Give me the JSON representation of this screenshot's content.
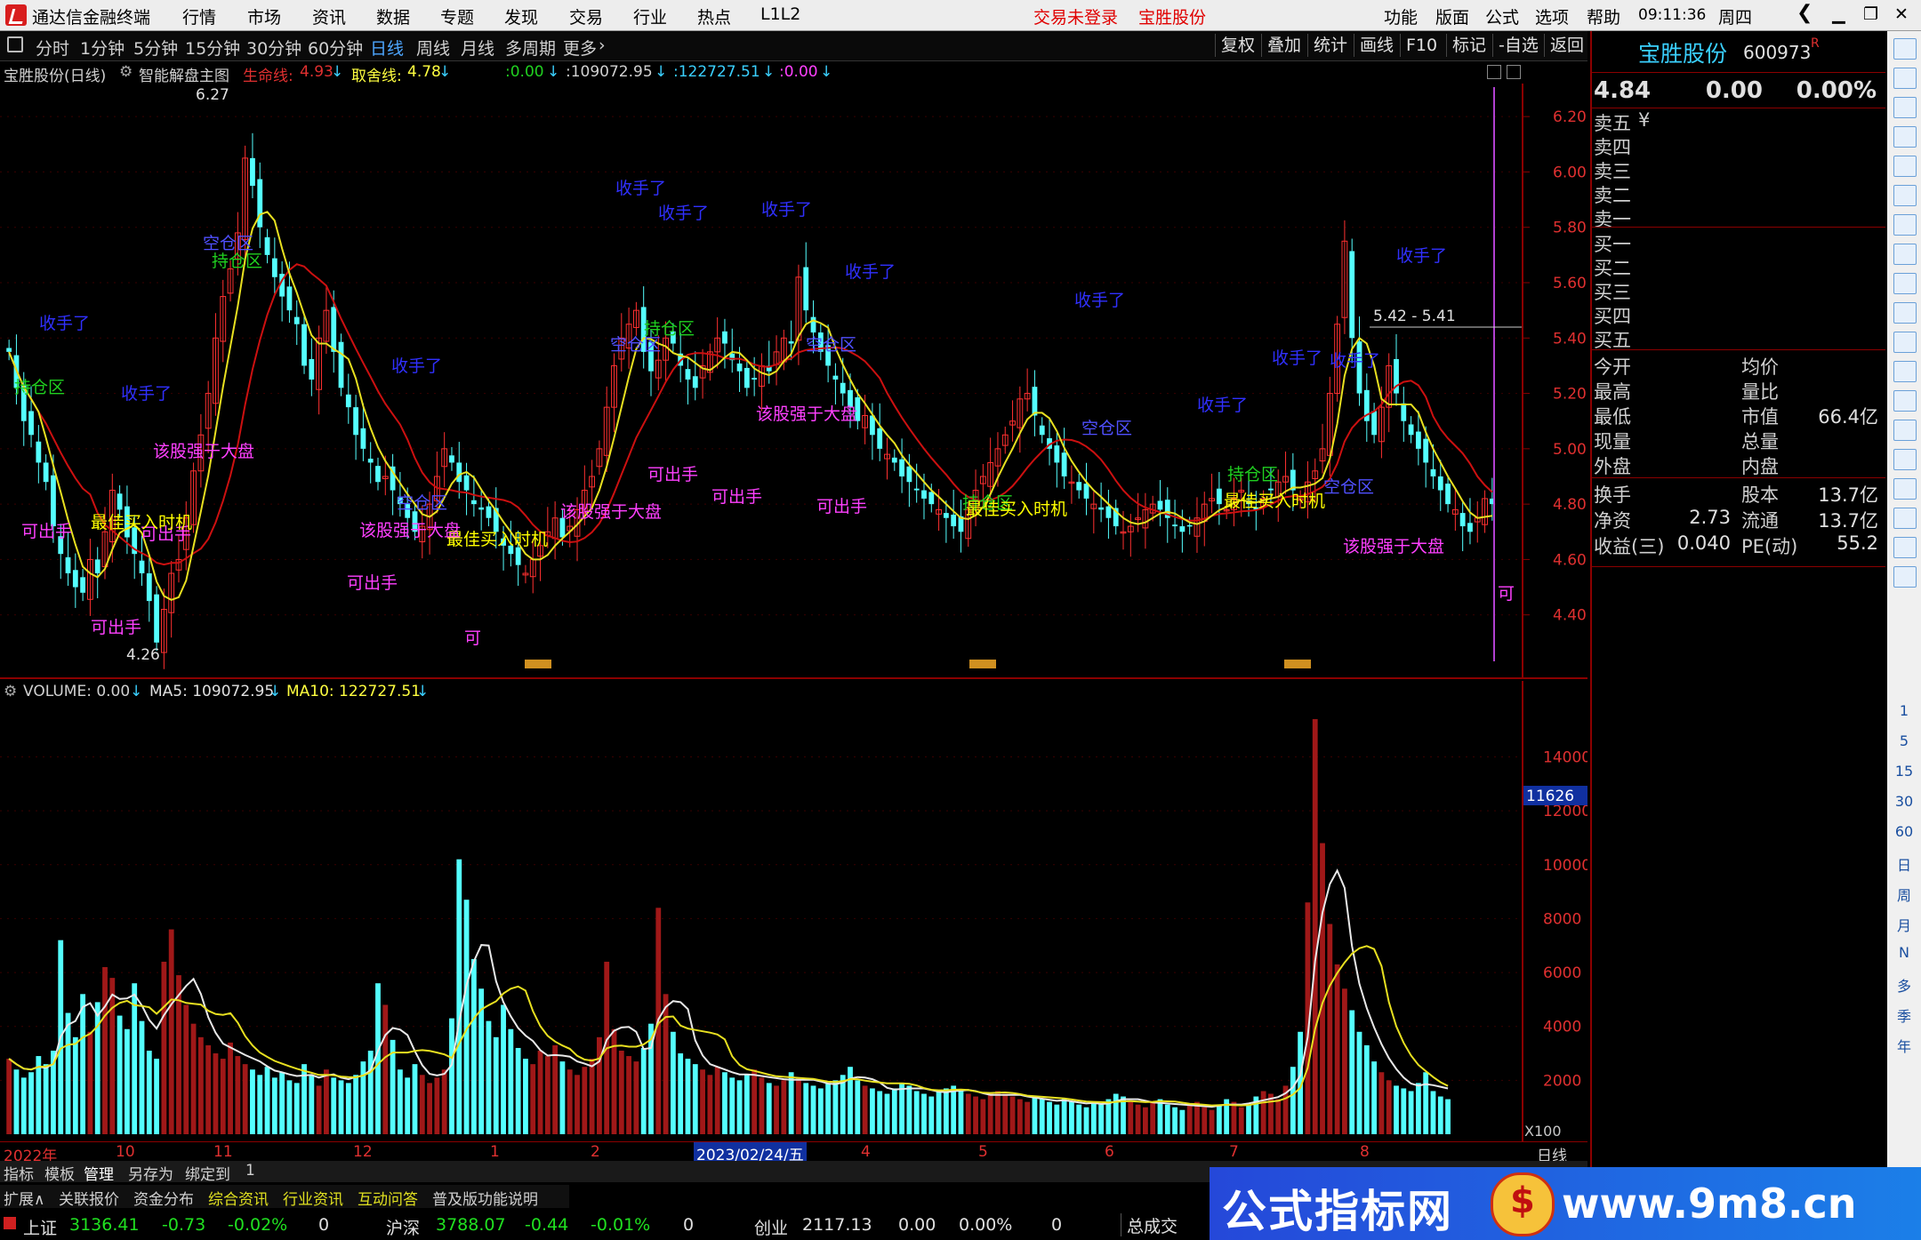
{
  "titlebar": {
    "app_title": "通达信金融终端",
    "menu": [
      "行情",
      "市场",
      "资讯",
      "数据",
      "专题",
      "发现",
      "交易",
      "行业",
      "热点",
      "L1L2"
    ],
    "login_status": "交易未登录",
    "stock_name": "宝胜股份",
    "right_menu": [
      "功能",
      "版面",
      "公式",
      "选项",
      "帮助"
    ],
    "time": "09:11:36",
    "weekday": "周四"
  },
  "toolbar": {
    "periods": [
      "分时",
      "1分钟",
      "5分钟",
      "15分钟",
      "30分钟",
      "60分钟",
      "日线",
      "周线",
      "月线",
      "多周期",
      "更多"
    ],
    "active_period": "日线",
    "right_buttons": [
      "复权",
      "叠加",
      "统计",
      "画线",
      "F10",
      "标记",
      "-自选",
      "返回"
    ]
  },
  "chart_header": {
    "stock": "宝胜股份(日线)",
    "indicator": "智能解盘主图",
    "life_line_label": "生命线:",
    "life_line_value": "4.93",
    "decision_line_label": "取舍线:",
    "decision_line_value": "4.78",
    "v1": ":0.00",
    "v2": ":109072.95",
    "v3": ":122727.51",
    "v4": ":0.00"
  },
  "volume_header": {
    "label": "VOLUME: 0.00",
    "ma5": "MA5: 109072.95",
    "ma10": "MA10: 122727.51"
  },
  "x_axis": {
    "labels": [
      "2022年",
      "10",
      "11",
      "12",
      "1",
      "2",
      "2023/02/24/五",
      "4",
      "5",
      "6",
      "7",
      "8"
    ],
    "period_label": "日线"
  },
  "bottom_tabs": [
    "指标",
    "模板",
    "管理",
    "另存为",
    "绑定到",
    "1"
  ],
  "bottom_tabs2": [
    "扩展∧",
    "关联报价",
    "资金分布",
    "综合资讯",
    "行业资讯",
    "互动问答",
    "普及版功能说明"
  ],
  "status_bar": {
    "idx1_name": "上证",
    "idx1_value": "3136.41",
    "idx1_change": "-0.73",
    "idx1_pct": "-0.02%",
    "idx1_vol": "0",
    "idx2_name": "沪深",
    "idx2_value": "3788.07",
    "idx2_change": "-0.44",
    "idx2_pct": "-0.01%",
    "idx2_vol": "0",
    "idx3_name": "创业",
    "idx3_value": "2117.13",
    "idx3_change": "0.00",
    "idx3_pct": "0.00%",
    "idx3_vol": "0",
    "total_label": "总成交"
  },
  "quote": {
    "name": "宝胜股份",
    "code": "600973",
    "flag": "R",
    "price": "4.84",
    "change": "0.00",
    "pct": "0.00%",
    "sell_levels": [
      "卖五",
      "卖四",
      "卖三",
      "卖二",
      "卖一"
    ],
    "sell5_flag": "¥",
    "buy_levels": [
      "买一",
      "买二",
      "买三",
      "买四",
      "买五"
    ],
    "stats_left": [
      "今开",
      "最高",
      "最低",
      "现量",
      "外盘"
    ],
    "stats_right": [
      "均价",
      "量比",
      "市值",
      "总量",
      "内盘"
    ],
    "market_value": "66.4亿",
    "fin_rows": [
      {
        "l": "换手",
        "lv": "",
        "r": "股本",
        "rv": "13.7亿"
      },
      {
        "l": "净资",
        "lv": "2.73",
        "r": "流通",
        "rv": "13.7亿"
      },
      {
        "l": "收益(三)",
        "lv": "0.040",
        "r": "PE(动)",
        "rv": "55.2"
      }
    ]
  },
  "side_icons": [
    "up-arrow",
    "down-arrow",
    "level2",
    "k-chart",
    "book",
    "trend",
    "bars",
    "news",
    "f10",
    "list",
    "ft",
    "f2",
    "time",
    "rsi",
    "rs",
    "move",
    "pen",
    "fs",
    "copy"
  ],
  "side_labels": [
    "1",
    "5",
    "15",
    "30",
    "60",
    "日",
    "周",
    "月",
    "N",
    "多",
    "季",
    "年"
  ],
  "watermark": {
    "brand": "公式指标网",
    "url": "www.9m8.cn"
  },
  "chart_data": {
    "type": "candlestick+volume",
    "price_axis": {
      "ticks": [
        "6.20",
        "6.00",
        "5.80",
        "5.60",
        "5.40",
        "5.20",
        "5.00",
        "4.80",
        "4.60",
        "4.40"
      ],
      "range": [
        4.2,
        6.3
      ]
    },
    "high_mark": "6.27",
    "low_mark": "4.26",
    "range_mark": "5.42 - 5.41",
    "volume_axis": {
      "ticks": [
        "14000",
        "12000",
        "10000",
        "8000",
        "6000",
        "4000",
        "2000"
      ],
      "range": [
        0,
        15500
      ],
      "unit": "X100"
    },
    "volume_current": "11626",
    "annotations": [
      {
        "t": "收手了",
        "c": "#3030ff"
      },
      {
        "t": "持仓区",
        "c": "#20d020"
      },
      {
        "t": "空仓区",
        "c": "#5050ff"
      },
      {
        "t": "可出手",
        "c": "#ff40ff"
      },
      {
        "t": "最佳买入时机",
        "c": "#ffff00"
      },
      {
        "t": "该股强于大盘",
        "c": "#ff40ff"
      }
    ],
    "closes": [
      5.35,
      5.22,
      5.1,
      5.05,
      4.95,
      4.88,
      4.72,
      4.62,
      4.55,
      4.5,
      4.48,
      4.6,
      4.55,
      4.7,
      4.85,
      4.78,
      4.68,
      4.62,
      4.55,
      4.45,
      4.3,
      4.42,
      4.55,
      4.6,
      4.75,
      4.92,
      5.05,
      5.2,
      5.4,
      5.55,
      5.65,
      5.78,
      6.05,
      5.95,
      5.8,
      5.7,
      5.62,
      5.55,
      5.5,
      5.45,
      5.3,
      5.25,
      5.4,
      5.5,
      5.35,
      5.22,
      5.15,
      5.05,
      5.0,
      4.95,
      4.88,
      4.9,
      4.85,
      4.8,
      4.75,
      4.7,
      4.72,
      4.8,
      4.9,
      5.0,
      4.95,
      4.88,
      4.85,
      4.8,
      4.78,
      4.75,
      4.7,
      4.65,
      4.62,
      4.58,
      4.55,
      4.6,
      4.65,
      4.7,
      4.75,
      4.68,
      4.72,
      4.78,
      4.85,
      4.9,
      5.0,
      5.15,
      5.3,
      5.4,
      5.45,
      5.5,
      5.35,
      5.28,
      5.32,
      5.4,
      5.38,
      5.3,
      5.25,
      5.22,
      5.3,
      5.35,
      5.4,
      5.38,
      5.32,
      5.28,
      5.22,
      5.25,
      5.3,
      5.28,
      5.35,
      5.4,
      5.38,
      5.62,
      5.5,
      5.42,
      5.35,
      5.3,
      5.25,
      5.2,
      5.15,
      5.1,
      5.12,
      5.05,
      5.0,
      4.98,
      4.95,
      4.9,
      4.88,
      4.85,
      4.82,
      4.8,
      4.78,
      4.75,
      4.72,
      4.7,
      4.78,
      4.85,
      4.9,
      4.95,
      5.0,
      5.05,
      5.1,
      5.18,
      5.2,
      5.12,
      5.05,
      5.0,
      4.95,
      4.9,
      4.88,
      4.85,
      4.82,
      4.8,
      4.78,
      4.75,
      4.72,
      4.7,
      4.72,
      4.75,
      4.78,
      4.8,
      4.78,
      4.75,
      4.72,
      4.7,
      4.72,
      4.75,
      4.8,
      4.82,
      4.8,
      4.78,
      4.82,
      4.85,
      4.8,
      4.78,
      4.82,
      4.85,
      4.88,
      4.9,
      4.85,
      4.82,
      4.88,
      4.92,
      5.0,
      5.2,
      5.45,
      5.75,
      5.4,
      5.2,
      5.1,
      5.05,
      5.15,
      5.3,
      5.2,
      5.1,
      5.05,
      5.0,
      4.95,
      4.9,
      4.85,
      4.8,
      4.78,
      4.72,
      4.7,
      4.75,
      4.82,
      4.8
    ],
    "volumes": [
      2800,
      2400,
      2100,
      2300,
      2900,
      2600,
      3100,
      7200,
      4500,
      3600,
      5200,
      3800,
      4900,
      6200,
      5800,
      4400,
      3900,
      5600,
      4200,
      3100,
      2800,
      6400,
      7600,
      5900,
      4800,
      4100,
      3600,
      3300,
      3000,
      2800,
      3400,
      2900,
      2600,
      2400,
      2200,
      2500,
      2100,
      2300,
      2000,
      1900,
      2600,
      2200,
      1800,
      2400,
      2100,
      2000,
      1900,
      2200,
      2700,
      3100,
      5600,
      4800,
      3500,
      2400,
      2100,
      2600,
      2200,
      1900,
      2100,
      2400,
      4300,
      10200,
      8700,
      6500,
      5400,
      4200,
      3600,
      4800,
      3900,
      3200,
      2800,
      2600,
      3100,
      2900,
      3300,
      2700,
      2400,
      2200,
      2500,
      2800,
      3600,
      6400,
      3900,
      3100,
      2900,
      2700,
      3200,
      4100,
      8400,
      5200,
      3800,
      3000,
      2800,
      2600,
      2400,
      2200,
      2500,
      2300,
      2100,
      2000,
      2200,
      2400,
      2100,
      1900,
      1800,
      2000,
      2300,
      2100,
      1900,
      1800,
      1700,
      1900,
      2000,
      2200,
      2500,
      2000,
      1800,
      1700,
      1600,
      1500,
      1700,
      1900,
      1800,
      1600,
      1500,
      1400,
      1600,
      1700,
      1800,
      1600,
      1500,
      1400,
      1300,
      1500,
      1600,
      1500,
      1400,
      1300,
      1200,
      1400,
      1300,
      1200,
      1100,
      1300,
      1200,
      1100,
      1000,
      1200,
      1100,
      1300,
      1500,
      1400,
      1200,
      1100,
      1000,
      1200,
      1300,
      1100,
      1000,
      900,
      1100,
      1200,
      1000,
      900,
      1100,
      1300,
      1200,
      1000,
      1100,
      1400,
      1600,
      1500,
      1300,
      1800,
      2500,
      3800,
      8600,
      15400,
      10800,
      7800,
      6300,
      5400,
      4600,
      3800,
      3300,
      2700,
      2300,
      2000,
      1800,
      1700,
      1600,
      1900,
      2300,
      1600,
      1400,
      1300
    ]
  }
}
